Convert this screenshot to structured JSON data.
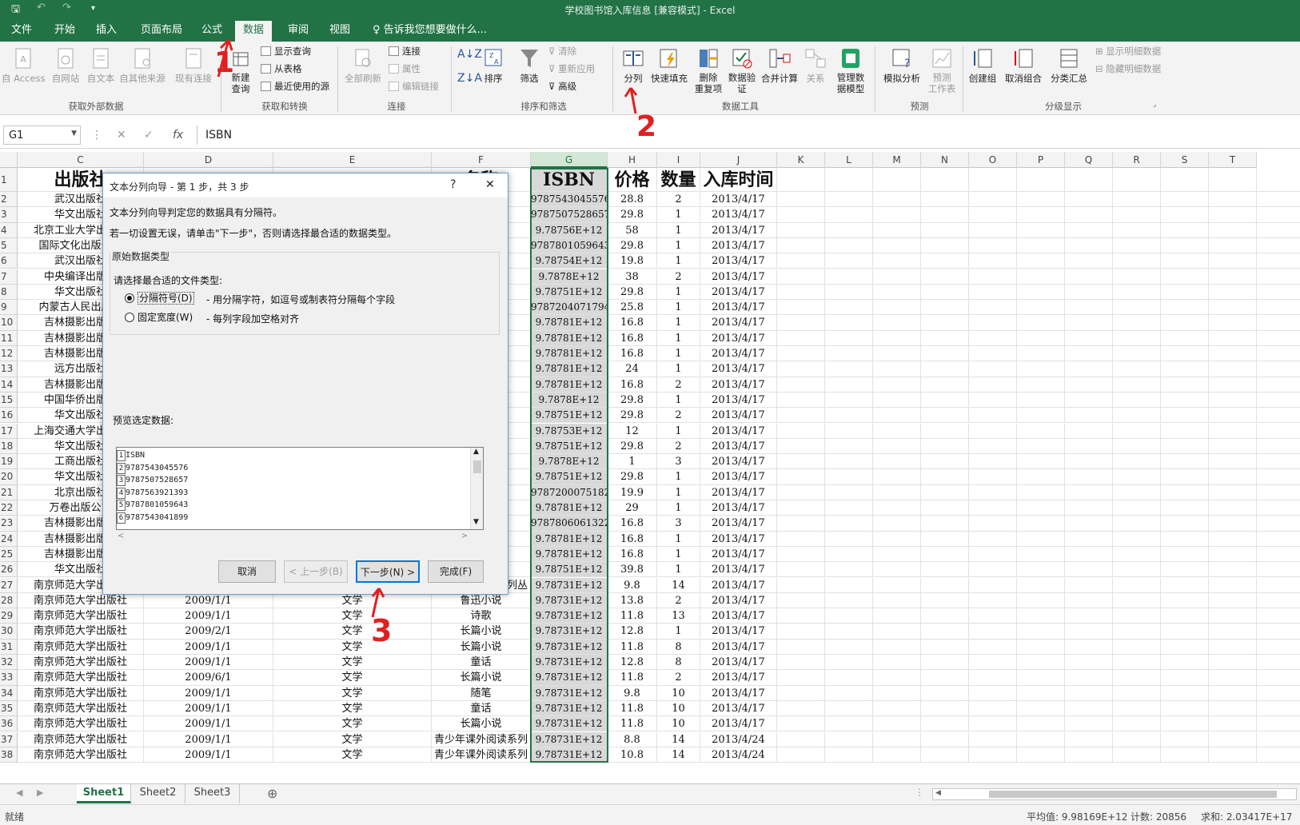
{
  "window": {
    "title": "学校图书馆入库信息  [兼容模式] - Excel"
  },
  "menu": [
    {
      "label": "文件",
      "active": false
    },
    {
      "label": "开始",
      "active": false
    },
    {
      "label": "插入",
      "active": false
    },
    {
      "label": "页面布局",
      "active": false
    },
    {
      "label": "公式",
      "active": false
    },
    {
      "label": "数据",
      "active": true
    },
    {
      "label": "审阅",
      "active": false
    },
    {
      "label": "视图",
      "active": false
    },
    {
      "label": "告诉我您想要做什么...",
      "active": false
    }
  ],
  "ribbon": {
    "get_external": {
      "label": "获取外部数据",
      "access": "自 Access",
      "web": "自网站",
      "text": "自文本",
      "other": "自其他来源",
      "existing": "现有连接"
    },
    "transform": {
      "label": "获取和转换",
      "new_query": "新建查询",
      "show_query": "显示查询",
      "from_table": "从表格",
      "recent": "最近使用的源"
    },
    "connections": {
      "label": "连接",
      "refresh_all": "全部刷新",
      "connections": "连接",
      "properties": "属性",
      "edit_links": "编辑链接"
    },
    "sort_filter": {
      "label": "排序和筛选",
      "sort": "排序",
      "filter": "筛选",
      "clear": "清除",
      "reapply": "重新应用",
      "advanced": "高级"
    },
    "data_tools": {
      "label": "数据工具",
      "text_to_columns": "分列",
      "flash_fill": "快速填充",
      "remove_dup_1": "删除",
      "remove_dup_2": "重复项",
      "validation_1": "数据验",
      "validation_2": "证",
      "consolidate": "合并计算",
      "relations": "关系",
      "model_1": "管理数",
      "model_2": "据模型"
    },
    "forecast": {
      "label": "预测",
      "what_if": "模拟分析",
      "sheet_1": "预测",
      "sheet_2": "工作表"
    },
    "outline": {
      "label": "分级显示",
      "group": "创建组",
      "ungroup": "取消组合",
      "subtotal": "分类汇总",
      "show_detail": "显示明细数据",
      "hide_detail": "隐藏明细数据"
    }
  },
  "formula_bar": {
    "name_box": "G1",
    "content": "ISBN"
  },
  "columns": [
    "C",
    "D",
    "E",
    "F",
    "G",
    "H",
    "I",
    "J",
    "K",
    "L",
    "M",
    "N",
    "O",
    "P",
    "Q",
    "R",
    "S",
    "T"
  ],
  "header_row": {
    "C": "出版社",
    "F": "名称",
    "G": "ISBN",
    "H": "价格",
    "I": "数量",
    "J": "入库时间"
  },
  "rows": [
    {
      "n": "2",
      "c": "武汉出版社",
      "d": "",
      "e": "",
      "f": "物",
      "g": "9787543045576",
      "h": "28.8",
      "i": "2",
      "j": "2013/4/17"
    },
    {
      "n": "3",
      "c": "华文出版社",
      "d": "",
      "e": "",
      "f": "物",
      "g": "9787507528657",
      "h": "29.8",
      "i": "1",
      "j": "2013/4/17"
    },
    {
      "n": "4",
      "c": "北京工业大学出版社",
      "d": "",
      "e": "",
      "f": "销",
      "g": "9.78756E+12",
      "h": "58",
      "i": "1",
      "j": "2013/4/17"
    },
    {
      "n": "5",
      "c": "国际文化出版公司",
      "d": "",
      "e": "",
      "f": "说",
      "g": "9787801059643",
      "h": "29.8",
      "i": "1",
      "j": "2013/4/17"
    },
    {
      "n": "6",
      "c": "武汉出版社",
      "d": "",
      "e": "",
      "f": "",
      "g": "9.78754E+12",
      "h": "19.8",
      "i": "1",
      "j": "2013/4/17"
    },
    {
      "n": "7",
      "c": "中央编译出版社",
      "d": "",
      "e": "",
      "f": "",
      "g": "9.7878E+12",
      "h": "38",
      "i": "2",
      "j": "2013/4/17"
    },
    {
      "n": "8",
      "c": "华文出版社",
      "d": "",
      "e": "",
      "f": "",
      "g": "9.78751E+12",
      "h": "29.8",
      "i": "1",
      "j": "2013/4/17"
    },
    {
      "n": "9",
      "c": "内蒙古人民出版社",
      "d": "",
      "e": "",
      "f": "",
      "g": "9787204071794",
      "h": "25.8",
      "i": "1",
      "j": "2013/4/17"
    },
    {
      "n": "10",
      "c": "吉林摄影出版社",
      "d": "",
      "e": "",
      "f": "学",
      "g": "9.78781E+12",
      "h": "16.8",
      "i": "1",
      "j": "2013/4/17"
    },
    {
      "n": "11",
      "c": "吉林摄影出版社",
      "d": "",
      "e": "",
      "f": "学",
      "g": "9.78781E+12",
      "h": "16.8",
      "i": "1",
      "j": "2013/4/17"
    },
    {
      "n": "12",
      "c": "吉林摄影出版社",
      "d": "",
      "e": "",
      "f": "学",
      "g": "9.78781E+12",
      "h": "16.8",
      "i": "1",
      "j": "2013/4/17"
    },
    {
      "n": "13",
      "c": "远方出版社",
      "d": "",
      "e": "",
      "f": "读书系",
      "g": "9.78781E+12",
      "h": "24",
      "i": "1",
      "j": "2013/4/17"
    },
    {
      "n": "14",
      "c": "吉林摄影出版社",
      "d": "",
      "e": "",
      "f": "学",
      "g": "9.78781E+12",
      "h": "16.8",
      "i": "2",
      "j": "2013/4/17"
    },
    {
      "n": "15",
      "c": "中国华侨出版社",
      "d": "",
      "e": "",
      "f": "",
      "g": "9.7878E+12",
      "h": "29.8",
      "i": "1",
      "j": "2013/4/17"
    },
    {
      "n": "16",
      "c": "华文出版社",
      "d": "",
      "e": "",
      "f": "赏",
      "g": "9.78751E+12",
      "h": "29.8",
      "i": "2",
      "j": "2013/4/17"
    },
    {
      "n": "17",
      "c": "上海交通大学出版社",
      "d": "",
      "e": "",
      "f": "文",
      "g": "9.78753E+12",
      "h": "12",
      "i": "1",
      "j": "2013/4/17"
    },
    {
      "n": "18",
      "c": "华文出版社",
      "d": "",
      "e": "",
      "f": "",
      "g": "9.78751E+12",
      "h": "29.8",
      "i": "2",
      "j": "2013/4/17"
    },
    {
      "n": "19",
      "c": "工商出版社",
      "d": "",
      "e": "",
      "f": "",
      "g": "9.7878E+12",
      "h": "1",
      "i": "3",
      "j": "2013/4/17"
    },
    {
      "n": "20",
      "c": "华文出版社",
      "d": "",
      "e": "",
      "f": "说",
      "g": "9.78751E+12",
      "h": "29.8",
      "i": "1",
      "j": "2013/4/17"
    },
    {
      "n": "21",
      "c": "北京出版社",
      "d": "",
      "e": "",
      "f": "",
      "g": "9787200075182",
      "h": "19.9",
      "i": "1",
      "j": "2013/4/17"
    },
    {
      "n": "22",
      "c": "万卷出版公司",
      "d": "",
      "e": "",
      "f": "说",
      "g": "9.78781E+12",
      "h": "29",
      "i": "1",
      "j": "2013/4/17"
    },
    {
      "n": "23",
      "c": "吉林摄影出版社",
      "d": "",
      "e": "",
      "f": "学",
      "g": "9787806061322",
      "h": "16.8",
      "i": "3",
      "j": "2013/4/17"
    },
    {
      "n": "24",
      "c": "吉林摄影出版社",
      "d": "",
      "e": "",
      "f": "学",
      "g": "9.78781E+12",
      "h": "16.8",
      "i": "1",
      "j": "2013/4/17"
    },
    {
      "n": "25",
      "c": "吉林摄影出版社",
      "d": "",
      "e": "",
      "f": "学",
      "g": "9.78781E+12",
      "h": "16.8",
      "i": "1",
      "j": "2013/4/17"
    },
    {
      "n": "26",
      "c": "华文出版社",
      "d": "",
      "e": "",
      "f": "",
      "g": "9.78751E+12",
      "h": "39.8",
      "i": "1",
      "j": "2013/4/17"
    },
    {
      "n": "27",
      "c": "南京师范大学出版社",
      "d": "2009/4/1",
      "e": "中国文学",
      "f": "少年课外阅读系列丛",
      "g": "9.78731E+12",
      "h": "9.8",
      "i": "14",
      "j": "2013/4/17"
    },
    {
      "n": "28",
      "c": "南京师范大学出版社",
      "d": "2009/1/1",
      "e": "文学",
      "f": "鲁迅小说",
      "g": "9.78731E+12",
      "h": "13.8",
      "i": "2",
      "j": "2013/4/17"
    },
    {
      "n": "29",
      "c": "南京师范大学出版社",
      "d": "2009/1/1",
      "e": "文学",
      "f": "诗歌",
      "g": "9.78731E+12",
      "h": "11.8",
      "i": "13",
      "j": "2013/4/17"
    },
    {
      "n": "30",
      "c": "南京师范大学出版社",
      "d": "2009/2/1",
      "e": "文学",
      "f": "长篇小说",
      "g": "9.78731E+12",
      "h": "12.8",
      "i": "1",
      "j": "2013/4/17"
    },
    {
      "n": "31",
      "c": "南京师范大学出版社",
      "d": "2009/1/1",
      "e": "文学",
      "f": "长篇小说",
      "g": "9.78731E+12",
      "h": "11.8",
      "i": "8",
      "j": "2013/4/17"
    },
    {
      "n": "32",
      "c": "南京师范大学出版社",
      "d": "2009/1/1",
      "e": "文学",
      "f": "童话",
      "g": "9.78731E+12",
      "h": "12.8",
      "i": "8",
      "j": "2013/4/17"
    },
    {
      "n": "33",
      "c": "南京师范大学出版社",
      "d": "2009/6/1",
      "e": "文学",
      "f": "长篇小说",
      "g": "9.78731E+12",
      "h": "11.8",
      "i": "2",
      "j": "2013/4/17"
    },
    {
      "n": "34",
      "c": "南京师范大学出版社",
      "d": "2009/1/1",
      "e": "文学",
      "f": "随笔",
      "g": "9.78731E+12",
      "h": "9.8",
      "i": "10",
      "j": "2013/4/17"
    },
    {
      "n": "35",
      "c": "南京师范大学出版社",
      "d": "2009/1/1",
      "e": "文学",
      "f": "童话",
      "g": "9.78731E+12",
      "h": "11.8",
      "i": "10",
      "j": "2013/4/17"
    },
    {
      "n": "36",
      "c": "南京师范大学出版社",
      "d": "2009/1/1",
      "e": "文学",
      "f": "长篇小说",
      "g": "9.78731E+12",
      "h": "11.8",
      "i": "10",
      "j": "2013/4/17"
    },
    {
      "n": "37",
      "c": "南京师范大学出版社",
      "d": "2009/1/1",
      "e": "文学",
      "f": "青少年课外阅读系列",
      "g": "9.78731E+12",
      "h": "8.8",
      "i": "14",
      "j": "2013/4/24"
    },
    {
      "n": "38",
      "c": "南京师范大学出版社",
      "d": "2009/1/1",
      "e": "文学",
      "f": "青少年课外阅读系列",
      "g": "9.78731E+12",
      "h": "10.8",
      "i": "14",
      "j": "2013/4/24"
    }
  ],
  "dialog": {
    "title": "文本分列向导 - 第 1 步，共 3 步",
    "help": "?",
    "close": "✕",
    "line1": "文本分列向导判定您的数据具有分隔符。",
    "line2": "若一切设置无误，请单击\"下一步\"，否则请选择最合适的数据类型。",
    "group_title": "原始数据类型",
    "group_prompt": "请选择最合适的文件类型:",
    "opt_delimited": "分隔符号(D)",
    "opt_delimited_desc": "- 用分隔字符，如逗号或制表符分隔每个字段",
    "opt_fixed": "固定宽度(W)",
    "opt_fixed_desc": "- 每列字段加空格对齐",
    "preview_label": "预览选定数据:",
    "preview": [
      {
        "n": "1",
        "v": "ISBN"
      },
      {
        "n": "2",
        "v": "9787543045576"
      },
      {
        "n": "3",
        "v": "9787507528657"
      },
      {
        "n": "4",
        "v": "9787563921393"
      },
      {
        "n": "5",
        "v": "9787801059643"
      },
      {
        "n": "6",
        "v": "9787543041899"
      }
    ],
    "btn_cancel": "取消",
    "btn_back": "< 上一步(B)",
    "btn_next": "下一步(N) >",
    "btn_finish": "完成(F)"
  },
  "sheets": [
    "Sheet1",
    "Sheet2",
    "Sheet3"
  ],
  "status": {
    "ready": "就绪",
    "average": "平均值: 9.98169E+12",
    "count": "计数: 20856",
    "sum": "求和: 2.03417E+17"
  },
  "annotations": [
    "1",
    "2",
    "3"
  ],
  "colors": {
    "excel_green": "#217346",
    "annotation_red": "#e02020",
    "dialog_border": "#6d9bd1"
  }
}
